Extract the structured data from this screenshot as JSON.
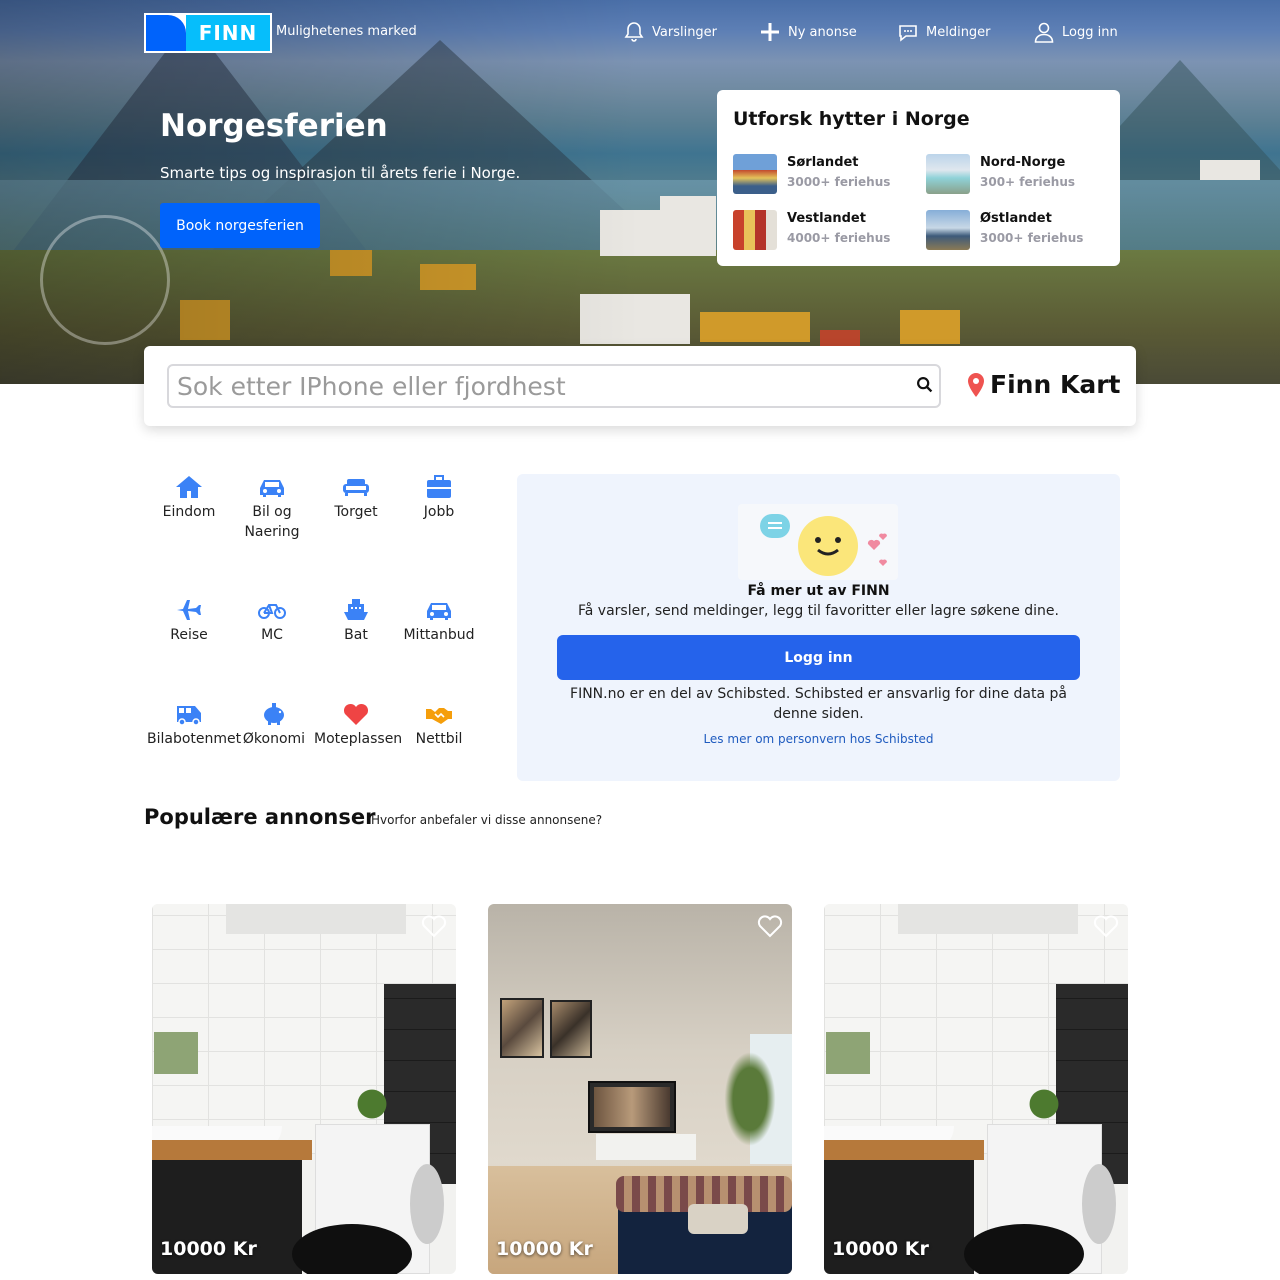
{
  "header": {
    "logo_text": "FINN",
    "tagline": "Mulighetenes marked",
    "nav": [
      {
        "label": "Varslinger",
        "icon": "bell-icon"
      },
      {
        "label": "Ny anonse",
        "icon": "plus-icon"
      },
      {
        "label": "Meldinger",
        "icon": "chat-icon"
      },
      {
        "label": "Logg inn",
        "icon": "user-icon"
      }
    ]
  },
  "hero": {
    "title": "Norgesferien",
    "subtitle": "Smarte tips og inspirasjon til årets ferie i Norge.",
    "button": "Book norgesferien"
  },
  "cabins": {
    "title": "Utforsk hytter i Norge",
    "regions": [
      {
        "name": "Sørlandet",
        "count": "3000+ feriehus"
      },
      {
        "name": "Nord-Norge",
        "count": "300+ feriehus"
      },
      {
        "name": "Vestlandet",
        "count": "4000+ feriehus"
      },
      {
        "name": "Østlandet",
        "count": "3000+ feriehus"
      }
    ]
  },
  "search": {
    "placeholder": "Sok etter IPhone eller fjordhest",
    "value": "",
    "map_label": "Finn Kart"
  },
  "categories": [
    {
      "label": "Eindom",
      "icon": "house-icon"
    },
    {
      "label": "Bil og\nNaering",
      "icon": "car-icon"
    },
    {
      "label": "Torget",
      "icon": "sofa-icon"
    },
    {
      "label": "Jobb",
      "icon": "briefcase-icon"
    },
    {
      "label": "Reise",
      "icon": "plane-icon"
    },
    {
      "label": "MC",
      "icon": "bicycle-icon"
    },
    {
      "label": "Bat",
      "icon": "ship-icon"
    },
    {
      "label": "Mittanbud",
      "icon": "car-icon"
    },
    {
      "label": "Bilabotenmet",
      "icon": "van-icon"
    },
    {
      "label": "Økonomi",
      "icon": "piggy-bank-icon"
    },
    {
      "label": "Moteplassen",
      "icon": "heart-icon"
    },
    {
      "label": "Nettbil",
      "icon": "handshake-icon"
    }
  ],
  "login_card": {
    "title": "Få mer ut av FINN",
    "description": "Få varsler, send meldinger, legg til favoritter eller lagre søkene dine.",
    "button": "Logg inn",
    "legal": "FINN.no er en del av Schibsted. Schibsted er ansvarlig for dine data på denne siden.",
    "link": "Les mer om personvern hos Schibsted"
  },
  "popular": {
    "title": "Populære annonser",
    "why": "Hvorfor anbefaler vi disse annonsene?",
    "ads": [
      {
        "price": "10000 Kr",
        "photo": "bathroom"
      },
      {
        "price": "10000 Kr",
        "photo": "living-room"
      },
      {
        "price": "10000 Kr",
        "photo": "bathroom"
      }
    ]
  },
  "colors": {
    "brand_blue": "#0063fb",
    "brand_cyan": "#06befb",
    "button_blue": "#2563eb",
    "category_icon": "#3b82f6",
    "heart_red": "#ef4444",
    "handshake_orange": "#f59e0b"
  }
}
